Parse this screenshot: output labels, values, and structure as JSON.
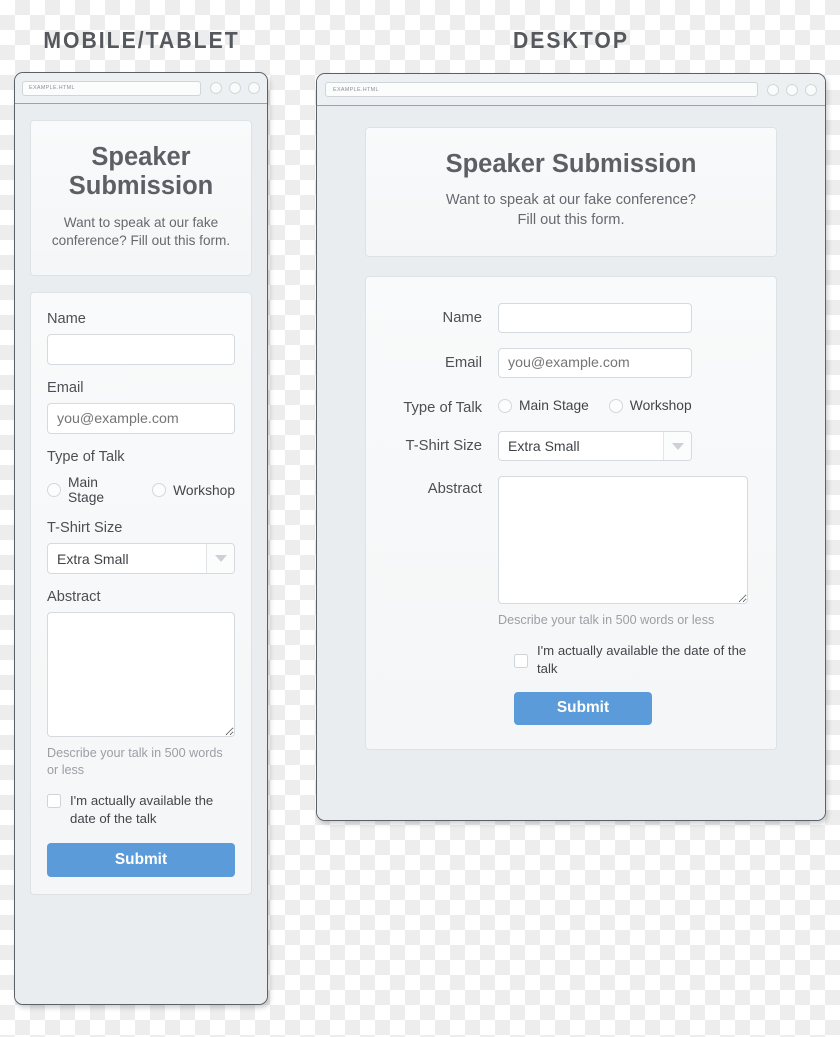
{
  "sections": {
    "mobile_title": "MOBILE/TABLET",
    "desktop_title": "DESKTOP"
  },
  "browser": {
    "url": "EXAMPLE.HTML"
  },
  "hero": {
    "title": "Speaker Submission",
    "title_line1": "Speaker",
    "title_line2": "Submission",
    "subtitle_mobile": "Want to speak at our fake conference? Fill out this form.",
    "subtitle_desktop_line1": "Want to speak at our fake conference?",
    "subtitle_desktop_line2": "Fill out this form."
  },
  "form": {
    "name": {
      "label": "Name",
      "value": "",
      "placeholder": ""
    },
    "email": {
      "label": "Email",
      "value": "",
      "placeholder": "you@example.com"
    },
    "type_of_talk": {
      "label": "Type of Talk",
      "options": [
        {
          "label": "Main Stage",
          "selected": false
        },
        {
          "label": "Workshop",
          "selected": false
        }
      ]
    },
    "tshirt": {
      "label": "T-Shirt Size",
      "selected": "Extra Small"
    },
    "abstract": {
      "label": "Abstract",
      "value": "",
      "helper": "Describe your talk in 500 words or less"
    },
    "availability": {
      "label": "I'm actually available the date of the talk",
      "checked": false
    },
    "submit_label": "Submit"
  },
  "colors": {
    "accent_blue": "#5b9bd9",
    "frame_border": "#5b6168",
    "chrome_bg": "#edf0f2",
    "viewport_bg": "#e9edf0",
    "panel_bg": "#f7f9fa",
    "heading_text": "#5c6065",
    "body_text": "#4c5055",
    "muted_text": "#9ba0a5",
    "placeholder_text": "#b7bcc1"
  }
}
